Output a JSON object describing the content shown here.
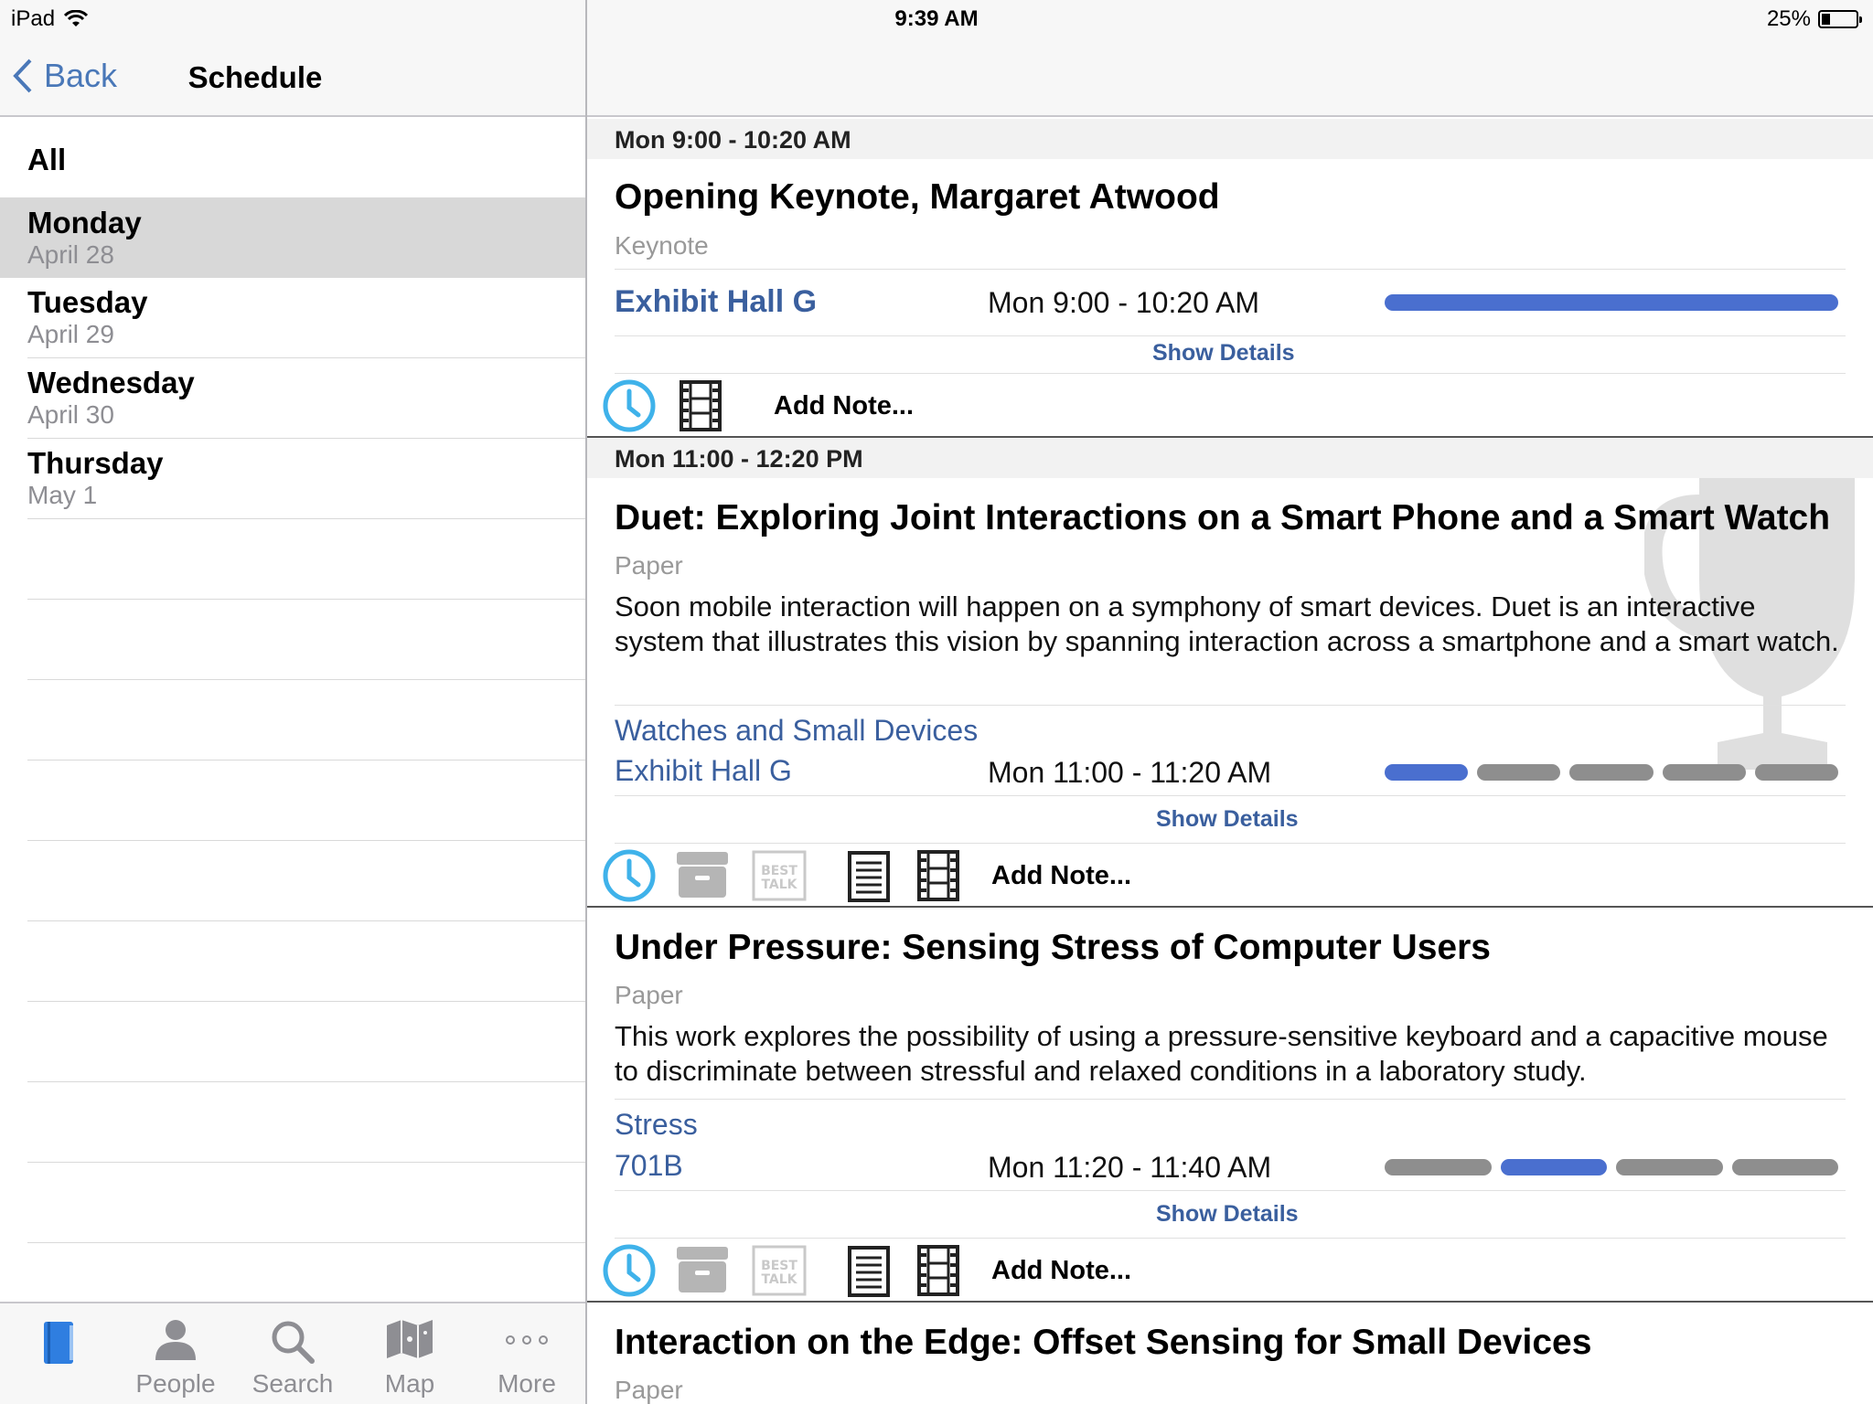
{
  "status_bar": {
    "device": "iPad",
    "time": "9:39 AM",
    "battery_percent": "25%",
    "battery_level": 0.25
  },
  "master": {
    "back_label": "Back",
    "title": "Schedule",
    "all_label": "All",
    "days": [
      {
        "name": "Monday",
        "date": "April 28",
        "selected": true
      },
      {
        "name": "Tuesday",
        "date": "April 29",
        "selected": false
      },
      {
        "name": "Wednesday",
        "date": "April 30",
        "selected": false
      },
      {
        "name": "Thursday",
        "date": "May 1",
        "selected": false
      }
    ]
  },
  "tabbar": {
    "tabs": [
      {
        "label": "",
        "icon": "book-icon",
        "active": true
      },
      {
        "label": "People",
        "icon": "person-icon"
      },
      {
        "label": "Search",
        "icon": "search-icon"
      },
      {
        "label": "Map",
        "icon": "map-icon"
      },
      {
        "label": "More",
        "icon": "more-icon"
      }
    ]
  },
  "sessions": [
    {
      "header": "Mon 9:00 - 10:20 AM",
      "items": [
        {
          "title": "Opening Keynote, Margaret Atwood",
          "type": "Keynote",
          "room": "Exhibit Hall G",
          "time": "Mon 9:00 - 10:20 AM",
          "show_details": "Show Details",
          "add_note": "Add Note...",
          "icons": [
            "clock-icon",
            "film-icon"
          ]
        }
      ]
    },
    {
      "header": "Mon 11:00 - 12:20 PM",
      "items": [
        {
          "title": "Duet: Exploring Joint Interactions on a Smart Phone and a Smart Watch",
          "type": "Paper",
          "abstract": "Soon mobile interaction will happen on a symphony of smart devices. Duet is an interactive system that illustrates this vision by spanning interaction across a smartphone and a smart watch.",
          "session_name": "Watches and Small Devices",
          "room": "Exhibit Hall G",
          "time": "Mon 11:00 - 11:20 AM",
          "show_details": "Show Details",
          "add_note": "Add Note...",
          "award": "trophy-icon",
          "icons": [
            "clock-icon",
            "archive-icon",
            "best-talk-icon",
            "document-icon",
            "film-icon"
          ],
          "best_talk_text": "BEST TALK"
        },
        {
          "title": "Under Pressure: Sensing Stress of Computer Users",
          "type": "Paper",
          "abstract": "This work explores the possibility of using a pressure-sensitive keyboard and a capacitive mouse to discriminate between stressful and relaxed conditions in a laboratory study.",
          "session_name": "Stress",
          "room": "701B",
          "time": "Mon 11:20 - 11:40 AM",
          "show_details": "Show Details",
          "add_note": "Add Note...",
          "icons": [
            "clock-icon",
            "archive-icon",
            "best-talk-icon",
            "document-icon",
            "film-icon"
          ],
          "best_talk_text": "BEST TALK"
        },
        {
          "title": "Interaction on the Edge: Offset Sensing for Small Devices",
          "type": "Paper"
        }
      ]
    }
  ],
  "timeline": {
    "keynote": {
      "segments": 1,
      "active_index": 0
    },
    "duet": {
      "segments": 5,
      "active_index": 0
    },
    "under_pressure": {
      "segments": 4,
      "active_index": 1
    }
  },
  "colors": {
    "accent": "#4a78b8",
    "link": "#3a5f9e",
    "bar_active": "#4a6fcf",
    "bar_inactive": "#8e8e8e",
    "clock": "#3fb2ea",
    "selected_row": "#d8d8d8",
    "tab_active": "#2f7ee0"
  }
}
